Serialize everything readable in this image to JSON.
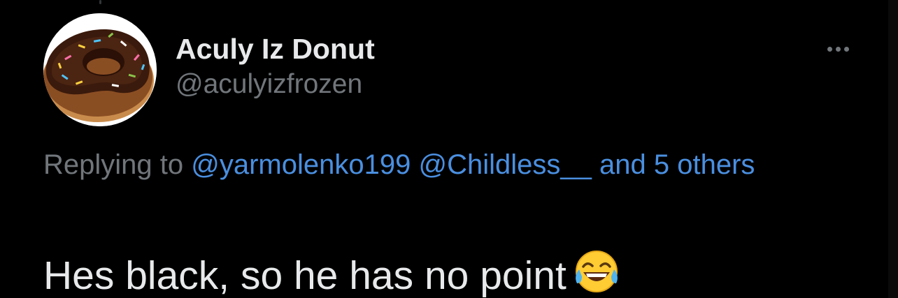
{
  "tweet": {
    "author": {
      "display_name": "Aculy Iz Donut",
      "handle": "@aculyizfrozen",
      "avatar_icon": "chocolate-donut-avatar"
    },
    "more_icon": "more-horizontal-icon",
    "reply_context": {
      "prefix": "Replying to",
      "mentions": [
        "@yarmolenko199",
        "@Childless__"
      ],
      "others_label": "and 5 others"
    },
    "text": "Hes black, so he has no point",
    "emoji": "face-with-tears-of-joy"
  },
  "colors": {
    "background": "#000000",
    "primary_text": "#e7e9ea",
    "secondary_text": "#71767b",
    "link": "#4a8fe0"
  }
}
